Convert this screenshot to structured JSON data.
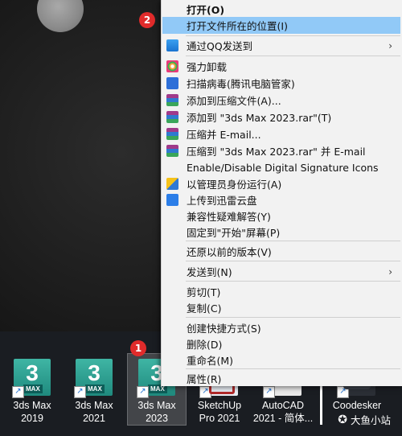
{
  "badges": {
    "one": "1",
    "two": "2"
  },
  "menu": {
    "items": [
      {
        "label": "打开(O)",
        "bold": true,
        "icon": "",
        "hl": false,
        "arrow": false
      },
      {
        "label": "打开文件所在的位置(I)",
        "bold": false,
        "icon": "",
        "hl": true,
        "arrow": false
      },
      {
        "label": "通过QQ发送到",
        "bold": false,
        "icon": "qq-icon",
        "hl": false,
        "arrow": true
      },
      {
        "label": "强力卸载",
        "bold": false,
        "icon": "uninstall-flower-icon",
        "hl": false,
        "arrow": false
      },
      {
        "label": "扫描病毒(腾讯电脑管家)",
        "bold": false,
        "icon": "tencent-shield-icon",
        "hl": false,
        "arrow": false
      },
      {
        "label": "添加到压缩文件(A)...",
        "bold": false,
        "icon": "winrar-icon",
        "hl": false,
        "arrow": false
      },
      {
        "label": "添加到 \"3ds Max 2023.rar\"(T)",
        "bold": false,
        "icon": "winrar-icon",
        "hl": false,
        "arrow": false
      },
      {
        "label": "压缩并 E-mail...",
        "bold": false,
        "icon": "winrar-icon",
        "hl": false,
        "arrow": false
      },
      {
        "label": "压缩到 \"3ds Max 2023.rar\" 并 E-mail",
        "bold": false,
        "icon": "winrar-icon",
        "hl": false,
        "arrow": false
      },
      {
        "label": "Enable/Disable Digital Signature Icons",
        "bold": false,
        "icon": "",
        "hl": false,
        "arrow": false
      },
      {
        "label": "以管理员身份运行(A)",
        "bold": false,
        "icon": "uac-shield-icon",
        "hl": false,
        "arrow": false
      },
      {
        "label": "上传到迅雷云盘",
        "bold": false,
        "icon": "xunlei-bird-icon",
        "hl": false,
        "arrow": false
      },
      {
        "label": "兼容性疑难解答(Y)",
        "bold": false,
        "icon": "",
        "hl": false,
        "arrow": false
      },
      {
        "label": "固定到\"开始\"屏幕(P)",
        "bold": false,
        "icon": "",
        "hl": false,
        "arrow": false
      },
      {
        "label": "还原以前的版本(V)",
        "bold": false,
        "icon": "",
        "hl": false,
        "arrow": false
      },
      {
        "label": "发送到(N)",
        "bold": false,
        "icon": "",
        "hl": false,
        "arrow": true
      },
      {
        "label": "剪切(T)",
        "bold": false,
        "icon": "",
        "hl": false,
        "arrow": false
      },
      {
        "label": "复制(C)",
        "bold": false,
        "icon": "",
        "hl": false,
        "arrow": false
      },
      {
        "label": "创建快捷方式(S)",
        "bold": false,
        "icon": "",
        "hl": false,
        "arrow": false
      },
      {
        "label": "删除(D)",
        "bold": false,
        "icon": "",
        "hl": false,
        "arrow": false
      },
      {
        "label": "重命名(M)",
        "bold": false,
        "icon": "",
        "hl": false,
        "arrow": false
      },
      {
        "label": "属性(R)",
        "bold": false,
        "icon": "",
        "hl": false,
        "arrow": false
      }
    ]
  },
  "desktop": {
    "icons": [
      {
        "line1": "3ds Max",
        "line2": "2019",
        "icon": "3ds-max-icon"
      },
      {
        "line1": "3ds Max",
        "line2": "2021",
        "icon": "3ds-max-icon"
      },
      {
        "line1": "3ds Max",
        "line2": "2023",
        "icon": "3ds-max-icon"
      },
      {
        "line1": "SketchUp",
        "line2": "Pro 2021",
        "icon": "sketchup-icon"
      },
      {
        "line1": "AutoCAD",
        "line2": "2021 - 简体...",
        "icon": "autocad-icon"
      },
      {
        "line1": "Coodesker",
        "line2": "",
        "icon": "coodesker-icon"
      }
    ],
    "tile_text": {
      "three": "3",
      "max": "MAX"
    }
  },
  "watermark": {
    "text": "大鱼小站"
  },
  "colors": {
    "highlight": "#91c9f7",
    "badge": "#e02b2b",
    "menu_bg": "#f2f2f2"
  }
}
